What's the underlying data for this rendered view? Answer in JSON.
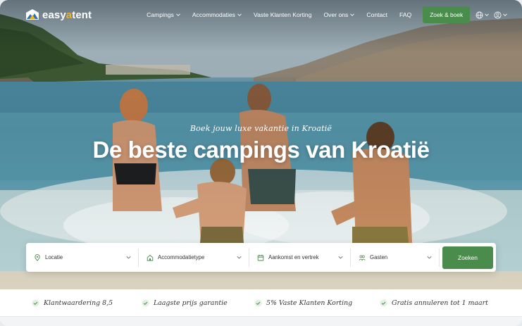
{
  "brand": {
    "name_pre": "easy",
    "name_accent": "a",
    "name_post": "tent",
    "accent_color": "#f2b21a"
  },
  "nav": {
    "items": [
      {
        "label": "Campings",
        "dropdown": true
      },
      {
        "label": "Accommodaties",
        "dropdown": true
      },
      {
        "label": "Vaste Klanten Korting",
        "dropdown": false
      },
      {
        "label": "Over ons",
        "dropdown": true
      },
      {
        "label": "Contact",
        "dropdown": false
      },
      {
        "label": "FAQ",
        "dropdown": false
      }
    ],
    "cta_label": "Zoek & boek",
    "cta_color": "#4a8c4c",
    "icons": [
      "globe-icon",
      "user-icon"
    ]
  },
  "hero": {
    "tagline": "Boek jouw luxe vakantie in Kroatië",
    "headline": "De beste campings van Kroatië"
  },
  "search": {
    "fields": [
      {
        "label": "Locatie",
        "icon": "location-pin-icon"
      },
      {
        "label": "Accommodatietype",
        "icon": "house-icon"
      },
      {
        "label": "Aankomst en vertrek",
        "icon": "calendar-icon"
      },
      {
        "label": "Gasten",
        "icon": "guests-icon"
      }
    ],
    "button_label": "Zoeken"
  },
  "usps": [
    "Klantwaardering 8,5",
    "Laagste prijs garantie",
    "5% Vaste Klanten Korting",
    "Gratis annuleren tot 1 maart"
  ]
}
